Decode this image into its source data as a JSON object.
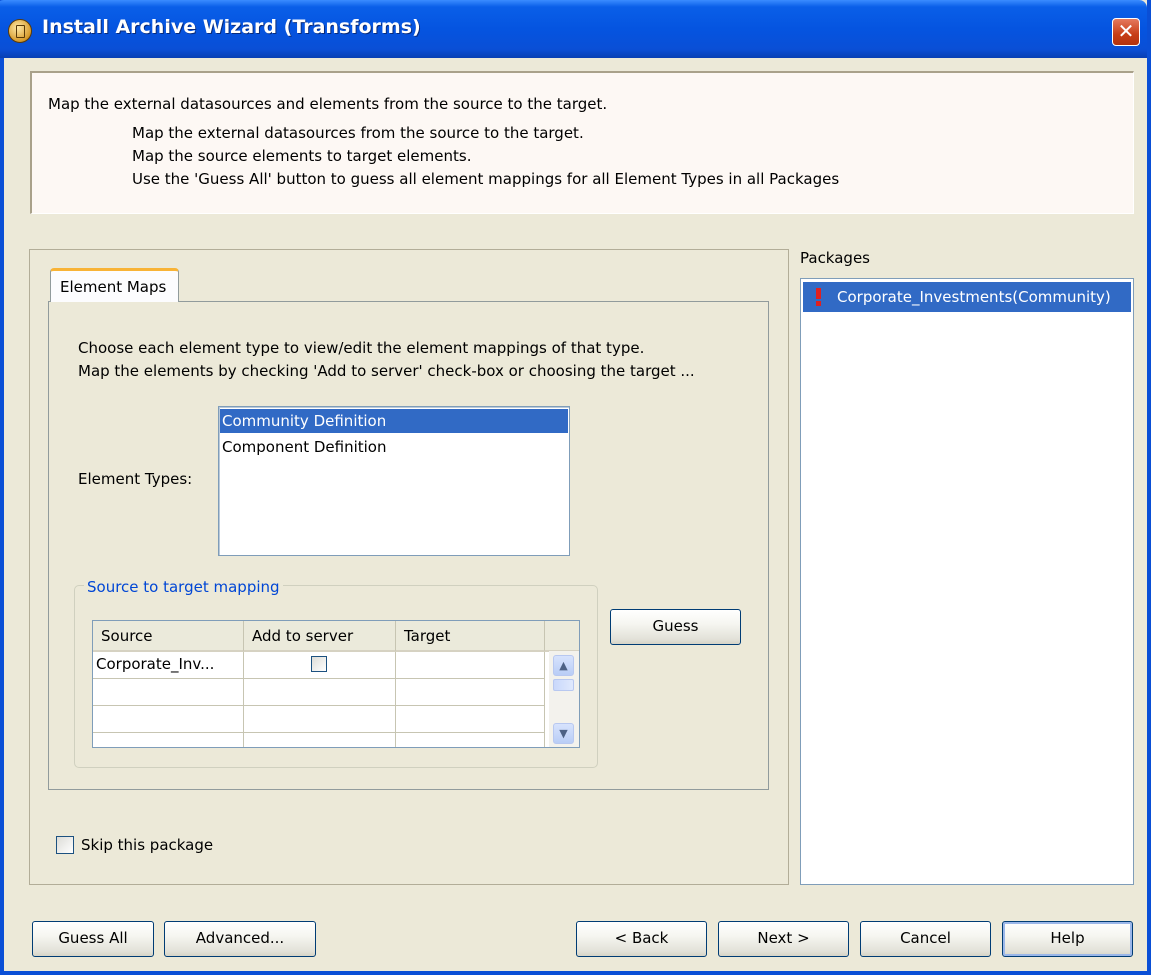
{
  "window": {
    "title": "Install Archive Wizard (Transforms)",
    "close_glyph": "✕"
  },
  "header": {
    "line1": "Map the external datasources and elements from the source to the target.",
    "line2": "Map the external datasources from the source to the target.",
    "line3": "Map the source elements to target elements.",
    "line4": "Use the 'Guess All' button to guess all element mappings for all Element Types in all Packages"
  },
  "tabs": {
    "element_maps": "Element Maps"
  },
  "element_maps": {
    "instruction1": "Choose each element type to view/edit the element mappings of that type.",
    "instruction2": "Map the elements by checking 'Add to server' check-box or choosing the target ...",
    "element_types_label": "Element Types:",
    "element_types": [
      "Community Definition",
      "Component Definition"
    ],
    "selected_index": 0
  },
  "mapping": {
    "group_label": "Source to target mapping",
    "columns": [
      "Source",
      "Add to server",
      "Target"
    ],
    "rows": [
      {
        "source": "Corporate_Inv...",
        "add_to_server": false,
        "target": ""
      }
    ],
    "guess_button": "Guess"
  },
  "packages": {
    "label": "Packages",
    "items": [
      "Corporate_Investments(Community)"
    ]
  },
  "skip": {
    "label": "Skip this package",
    "checked": false
  },
  "buttons": {
    "guess_all": "Guess All",
    "advanced": "Advanced...",
    "back": "< Back",
    "next": "Next >",
    "cancel": "Cancel",
    "help": "Help"
  },
  "icons": {
    "title": "archive-wizard-icon",
    "package_status": "warning-exclamation-icon",
    "scroll_up": "▲",
    "scroll_down": "▼"
  },
  "colors": {
    "titlebar": "#0a4fd6",
    "selection": "#316ac5",
    "group_label": "#0046d5",
    "warning": "#e02020"
  }
}
